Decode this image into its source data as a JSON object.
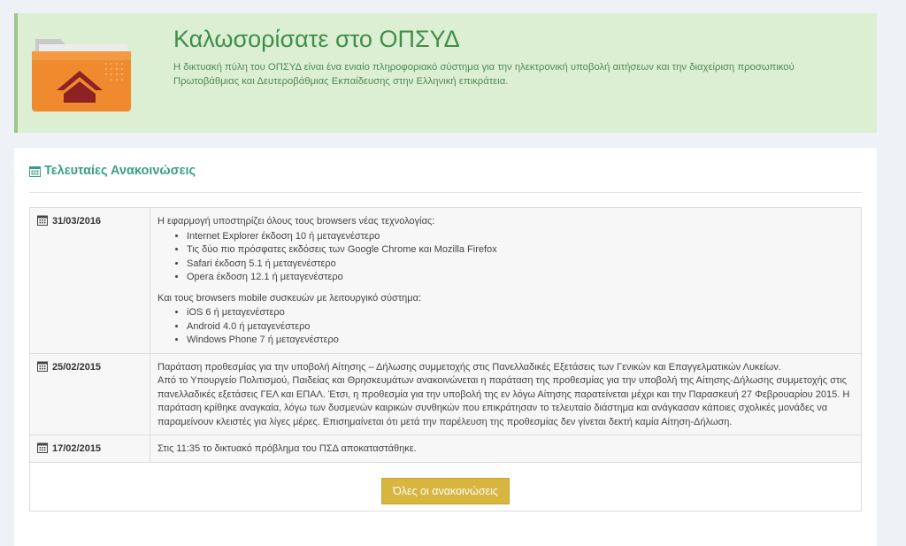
{
  "welcome": {
    "title": "Καλωσορίσατε στο ΟΠΣΥΔ",
    "description": "Η δικτυακή πύλη του ΟΠΣΥΔ είναι ένα ενιαίο πληροφοριακό σύστημα για την ηλεκτρονική υποβολή αιτήσεων και την διαχείριση προσωπικού Πρωτοβάθμιας και Δευτεροβάθμιας Εκπαίδευσης στην Ελληνική επικράτεια.",
    "icon": "folder-home-icon"
  },
  "announcements": {
    "title": "Τελευταίες Ανακοινώσεις",
    "icon": "calendar-icon",
    "items": [
      {
        "date": "31/03/2016",
        "intro": "Η εφαρμογή υποστηρίζει όλους τους browsers νέας τεχνολογίας:",
        "list1": [
          "Internet Explorer έκδοση 10 ή μεταγενέστερο",
          "Τις δύο πιο πρόσφατες εκδόσεις των Google Chrome και Mozilla Firefox",
          "Safari έκδοση 5.1 ή μεταγενέστερο",
          "Opera έκδοση 12.1 ή μεταγενέστερο"
        ],
        "intro2": "Και τους browsers mobile συσκευών με λειτουργικό σύστημα:",
        "list2": [
          "iOS 6 ή μεταγενέστερο",
          "Android 4.0 ή μεταγενέστερο",
          "Windows Phone 7 ή μεταγενέστερο"
        ]
      },
      {
        "date": "25/02/2015",
        "line1": "Παράταση προθεσμίας για την υποβολή Αίτησης – Δήλωσης συμμετοχής στις Πανελλαδικές Εξετάσεις των Γενικών και Επαγγελματικών Λυκείων.",
        "line2": "Από το Υπουργείο Πολιτισμού, Παιδείας και Θρησκευμάτων ανακοινώνεται η παράταση της προθεσμίας για την υποβολή της Αίτησης-Δήλωσης συμμετοχής στις πανελλαδικές εξετάσεις ΓΕΛ και ΕΠΑΛ. Έτσι, η προθεσμία για την υποβολή της εν λόγω Αίτησης παρατείνεται μέχρι και την Παρασκευή 27 Φεβρουαρίου 2015. Η παράταση κρίθηκε αναγκαία, λόγω των δυσμενών καιρικών συνθηκών που επικράτησαν το τελευταίο διάστημα και ανάγκασαν κάποιες σχολικές μονάδες να παραμείνουν κλειστές για λίγες μέρες. Επισημαίνεται ότι μετά την παρέλευση της προθεσμίας δεν γίνεται δεκτή καμία Αίτηση-Δήλωση."
      },
      {
        "date": "17/02/2015",
        "text": "Στις 11:35 το δικτυακό πρόβλημα του ΠΣΔ αποκαταστάθηκε."
      }
    ],
    "all_button": "Όλες οι ανακοινώσεις"
  },
  "colors": {
    "welcome_bg": "#dcefd3",
    "title_green": "#3f8e4a",
    "teal": "#3a9e86",
    "button_gold": "#d8b53f"
  }
}
